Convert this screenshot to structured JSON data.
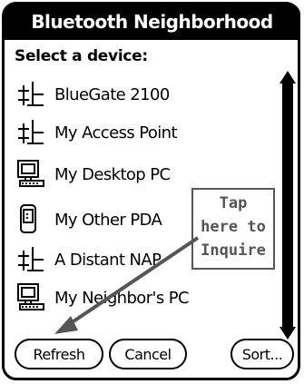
{
  "window": {
    "title": "Bluetooth Neighborhood"
  },
  "prompt": "Select a device:",
  "devices": [
    {
      "label": "BlueGate 2100",
      "icon": "access-point-icon"
    },
    {
      "label": "My Access Point",
      "icon": "access-point-icon"
    },
    {
      "label": "My Desktop PC",
      "icon": "desktop-pc-icon"
    },
    {
      "label": "My Other PDA",
      "icon": "pda-icon"
    },
    {
      "label": "A Distant NAP",
      "icon": "access-point-icon"
    },
    {
      "label": "My Neighbor's PC",
      "icon": "desktop-pc-icon"
    }
  ],
  "callout": {
    "lines": [
      "Tap",
      "here to",
      "Inquire"
    ]
  },
  "buttons": {
    "refresh": "Refresh",
    "cancel": "Cancel",
    "sort": "Sort..."
  },
  "colors": {
    "title_bar": "#000000",
    "callout": "#555555"
  }
}
